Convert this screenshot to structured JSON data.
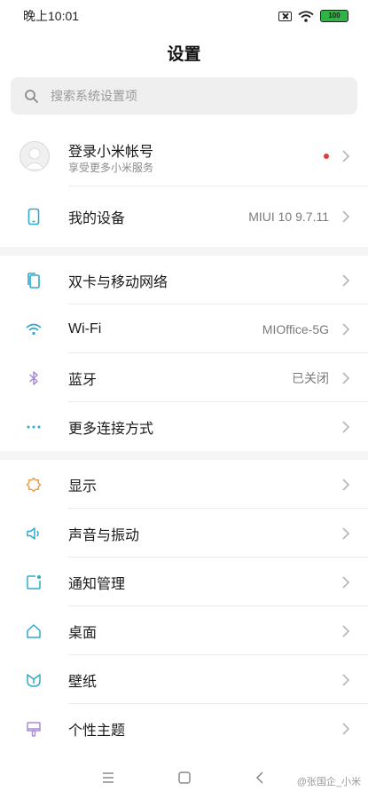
{
  "status_bar": {
    "time": "晚上10:01",
    "battery": "100"
  },
  "header": {
    "title": "设置"
  },
  "search": {
    "placeholder": "搜索系统设置项"
  },
  "account": {
    "title": "登录小米帐号",
    "subtitle": "享受更多小米服务"
  },
  "device": {
    "label": "我的设备",
    "value": "MIUI 10 9.7.11"
  },
  "connections": [
    {
      "label": "双卡与移动网络",
      "value": "",
      "icon": "sim-cards-icon"
    },
    {
      "label": "Wi-Fi",
      "value": "MIOffice-5G",
      "icon": "wifi-icon"
    },
    {
      "label": "蓝牙",
      "value": "已关闭",
      "icon": "bluetooth-icon"
    },
    {
      "label": "更多连接方式",
      "value": "",
      "icon": "more-dots-icon"
    }
  ],
  "personal": [
    {
      "label": "显示",
      "icon": "display-brightness-icon"
    },
    {
      "label": "声音与振动",
      "icon": "speaker-icon"
    },
    {
      "label": "通知管理",
      "icon": "notification-icon"
    },
    {
      "label": "桌面",
      "icon": "home-icon"
    },
    {
      "label": "壁纸",
      "icon": "wallpaper-icon"
    },
    {
      "label": "个性主题",
      "icon": "theme-brush-icon"
    }
  ],
  "watermark": "@张国企_小米",
  "colors": {
    "accent": "#30a9c9",
    "red_dot": "#e53935",
    "battery": "#2fb344",
    "section_gap": "#f5f5f5"
  }
}
